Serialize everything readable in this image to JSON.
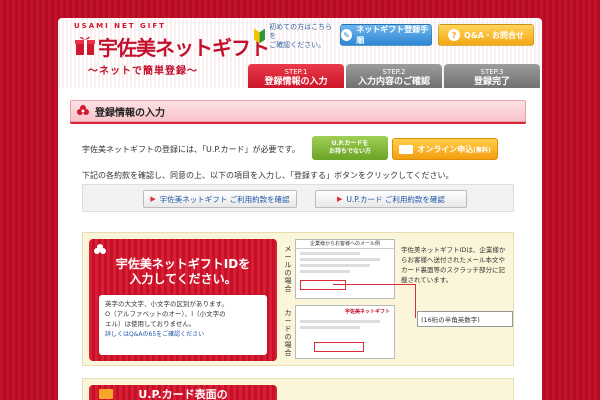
{
  "header": {
    "logo_sub": "USAMI NET GIFT",
    "logo_title": "宇佐美ネットギフト",
    "logo_tagline": "〜ネットで簡単登録〜",
    "first_time_text_1": "初めての方はこちらを",
    "first_time_text_2": "ご確認ください。",
    "register_button": "ネットギフト登録手順",
    "qa_button": "Q&A・お問合せ"
  },
  "steps": [
    {
      "num": "STEP.1",
      "name": "登録情報の入力",
      "active": true
    },
    {
      "num": "STEP.2",
      "name": "入力内容のご確認",
      "active": false
    },
    {
      "num": "STEP.3",
      "name": "登録完了",
      "active": false
    }
  ],
  "section": {
    "title": "登録情報の入力"
  },
  "intro": {
    "text": "宇佐美ネットギフトの登録には、「U.P.カード」が必要です。",
    "up_card_line1": "U.P.カードを",
    "up_card_line2": "お持ちでない方",
    "online_button": "オンライン申込",
    "online_button_suffix": "(無料)"
  },
  "instruction": "下記の各約款を確認し、同意の上、以下の項目を入力し、「登録する」ボタンをクリックしてください。",
  "terms": {
    "gift_terms": "宇佐美ネットギフト ご利用約款を確認",
    "card_terms": "U.P.カード ご利用約款を確認"
  },
  "id_panel": {
    "title_line1": "宇佐美ネットギフトIDを",
    "title_line2": "入力してください。",
    "note_line1": "英字の大文字、小文字の区別があります。",
    "note_line2": "O（アルファベットのオー）、l（小文字の",
    "note_line3": "エル）は使用しておりません。",
    "note_link": "詳しくはQ&Aの65をご確認ください",
    "mail_label": "メールの場合",
    "card_label": "カードの場合",
    "mail_header": "企業様からお客様へのメール例",
    "card_header": "宇佐美ネットギフト",
    "desc": "宇佐美ネットギフトIDは、企業様からお客様へ送付されたメール本文やカード裏面等のスクラッチ部分に記載されています。",
    "input_placeholder": "(16桁の半角英数字)"
  },
  "card_panel": {
    "title": "U.P.カード表面の"
  }
}
